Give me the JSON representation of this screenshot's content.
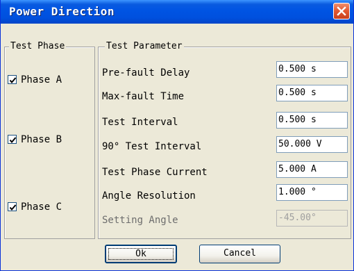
{
  "window": {
    "title": "Power Direction",
    "close_icon": "close-icon"
  },
  "test_phase": {
    "legend": "Test Phase",
    "items": [
      {
        "label": "Phase A",
        "checked": true
      },
      {
        "label": "Phase B",
        "checked": true
      },
      {
        "label": "Phase C",
        "checked": true
      }
    ]
  },
  "test_parameter": {
    "legend": "Test Parameter",
    "rows": [
      {
        "label": "Pre-fault Delay",
        "value": "0.500 s",
        "disabled": false
      },
      {
        "label": "Max-fault Time",
        "value": "0.500 s",
        "disabled": false
      },
      {
        "label": "Test Interval",
        "value": "0.500 s",
        "disabled": false
      },
      {
        "label": "90° Test Interval",
        "value": "50.000 V",
        "disabled": false
      },
      {
        "label": "Test Phase Current",
        "value": "5.000 A",
        "disabled": false
      },
      {
        "label": "Angle Resolution",
        "value": "1.000 °",
        "disabled": false
      },
      {
        "label": "Setting Angle",
        "value": "-45.00°",
        "disabled": true
      }
    ]
  },
  "buttons": {
    "ok_label": "Ok",
    "cancel_label": "Cancel"
  },
  "colors": {
    "titlebar": "#0054e3",
    "close_button": "#e45a33",
    "dialog_background": "#ece9d8"
  }
}
